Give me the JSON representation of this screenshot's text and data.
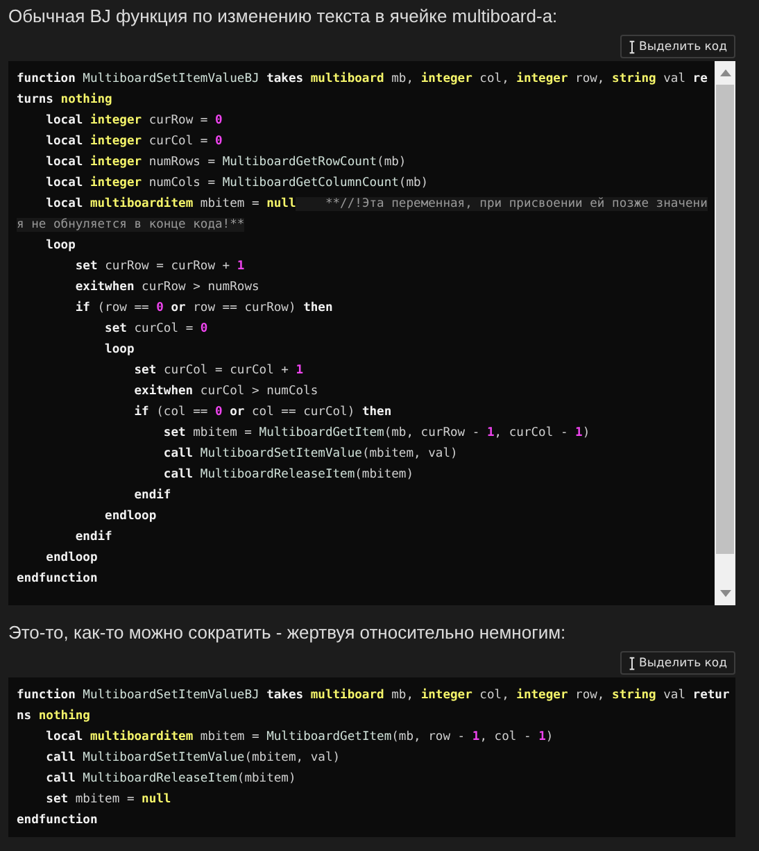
{
  "posts": [
    {
      "text": "Обычная BJ функция по изменению текста в ячейке multiboard-а:",
      "select_button": "Выделить код",
      "code": {
        "scrollable": true,
        "lines": [
          [
            {
              "kind": "kw",
              "text": "function "
            },
            {
              "kind": "fn",
              "text": "MultiboardSetItemValueBJ"
            },
            {
              "kind": "kw",
              "text": " takes "
            },
            {
              "kind": "type",
              "text": "multiboard"
            },
            {
              "kind": "plain",
              "text": " mb, "
            },
            {
              "kind": "type",
              "text": "integer"
            },
            {
              "kind": "plain",
              "text": " col, "
            },
            {
              "kind": "type",
              "text": "integer"
            },
            {
              "kind": "plain",
              "text": " row, "
            },
            {
              "kind": "type",
              "text": "string"
            },
            {
              "kind": "plain",
              "text": " val "
            },
            {
              "kind": "kw",
              "text": "re"
            }
          ],
          [
            {
              "kind": "kw",
              "text": "turns "
            },
            {
              "kind": "type",
              "text": "nothing"
            }
          ],
          [
            {
              "kind": "kw",
              "text": "    local "
            },
            {
              "kind": "type",
              "text": "integer"
            },
            {
              "kind": "plain",
              "text": " curRow = "
            },
            {
              "kind": "num",
              "text": "0"
            }
          ],
          [
            {
              "kind": "kw",
              "text": "    local "
            },
            {
              "kind": "type",
              "text": "integer"
            },
            {
              "kind": "plain",
              "text": " curCol = "
            },
            {
              "kind": "num",
              "text": "0"
            }
          ],
          [
            {
              "kind": "kw",
              "text": "    local "
            },
            {
              "kind": "type",
              "text": "integer"
            },
            {
              "kind": "plain",
              "text": " numRows = "
            },
            {
              "kind": "fn",
              "text": "MultiboardGetRowCount"
            },
            {
              "kind": "plain",
              "text": "(mb)"
            }
          ],
          [
            {
              "kind": "kw",
              "text": "    local "
            },
            {
              "kind": "type",
              "text": "integer"
            },
            {
              "kind": "plain",
              "text": " numCols = "
            },
            {
              "kind": "fn",
              "text": "MultiboardGetColumnCount"
            },
            {
              "kind": "plain",
              "text": "(mb)"
            }
          ],
          [
            {
              "kind": "kw",
              "text": "    local "
            },
            {
              "kind": "type",
              "text": "multiboarditem"
            },
            {
              "kind": "plain",
              "text": " mbitem = "
            },
            {
              "kind": "type",
              "text": "null"
            },
            {
              "kind": "comment",
              "text": "    **//!Эта переменная, при присвоении ей позже значени"
            }
          ],
          [
            {
              "kind": "comment",
              "text": "я не обнуляется в конце кода!**"
            }
          ],
          [
            {
              "kind": "kw",
              "text": "    loop"
            }
          ],
          [
            {
              "kind": "kw",
              "text": "        set "
            },
            {
              "kind": "plain",
              "text": "curRow = curRow + "
            },
            {
              "kind": "num",
              "text": "1"
            }
          ],
          [
            {
              "kind": "kw",
              "text": "        exitwhen "
            },
            {
              "kind": "plain",
              "text": "curRow > numRows"
            }
          ],
          [
            {
              "kind": "kw",
              "text": "        if "
            },
            {
              "kind": "plain",
              "text": "(row == "
            },
            {
              "kind": "num",
              "text": "0"
            },
            {
              "kind": "kw",
              "text": " or "
            },
            {
              "kind": "plain",
              "text": "row == curRow) "
            },
            {
              "kind": "kw",
              "text": "then"
            }
          ],
          [
            {
              "kind": "kw",
              "text": "            set "
            },
            {
              "kind": "plain",
              "text": "curCol = "
            },
            {
              "kind": "num",
              "text": "0"
            }
          ],
          [
            {
              "kind": "kw",
              "text": "            loop"
            }
          ],
          [
            {
              "kind": "kw",
              "text": "                set "
            },
            {
              "kind": "plain",
              "text": "curCol = curCol + "
            },
            {
              "kind": "num",
              "text": "1"
            }
          ],
          [
            {
              "kind": "kw",
              "text": "                exitwhen "
            },
            {
              "kind": "plain",
              "text": "curCol > numCols"
            }
          ],
          [
            {
              "kind": "kw",
              "text": "                if "
            },
            {
              "kind": "plain",
              "text": "(col == "
            },
            {
              "kind": "num",
              "text": "0"
            },
            {
              "kind": "kw",
              "text": " or "
            },
            {
              "kind": "plain",
              "text": "col == curCol) "
            },
            {
              "kind": "kw",
              "text": "then"
            }
          ],
          [
            {
              "kind": "kw",
              "text": "                    set "
            },
            {
              "kind": "plain",
              "text": "mbitem = "
            },
            {
              "kind": "fn",
              "text": "MultiboardGetItem"
            },
            {
              "kind": "plain",
              "text": "(mb, curRow - "
            },
            {
              "kind": "num",
              "text": "1"
            },
            {
              "kind": "plain",
              "text": ", curCol - "
            },
            {
              "kind": "num",
              "text": "1"
            },
            {
              "kind": "plain",
              "text": ")"
            }
          ],
          [
            {
              "kind": "kw",
              "text": "                    call "
            },
            {
              "kind": "fn",
              "text": "MultiboardSetItemValue"
            },
            {
              "kind": "plain",
              "text": "(mbitem, val)"
            }
          ],
          [
            {
              "kind": "kw",
              "text": "                    call "
            },
            {
              "kind": "fn",
              "text": "MultiboardReleaseItem"
            },
            {
              "kind": "plain",
              "text": "(mbitem)"
            }
          ],
          [
            {
              "kind": "kw",
              "text": "                endif"
            }
          ],
          [
            {
              "kind": "kw",
              "text": "            endloop"
            }
          ],
          [
            {
              "kind": "kw",
              "text": "        endif"
            }
          ],
          [
            {
              "kind": "kw",
              "text": "    endloop"
            }
          ],
          [
            {
              "kind": "kw",
              "text": "endfunction"
            }
          ]
        ]
      }
    },
    {
      "text": "Это-то, как-то можно сократить - жертвуя относительно немногим:",
      "select_button": "Выделить код",
      "code": {
        "scrollable": false,
        "lines": [
          [
            {
              "kind": "kw",
              "text": "function "
            },
            {
              "kind": "fn",
              "text": "MultiboardSetItemValueBJ"
            },
            {
              "kind": "kw",
              "text": " takes "
            },
            {
              "kind": "type",
              "text": "multiboard"
            },
            {
              "kind": "plain",
              "text": " mb, "
            },
            {
              "kind": "type",
              "text": "integer"
            },
            {
              "kind": "plain",
              "text": " col, "
            },
            {
              "kind": "type",
              "text": "integer"
            },
            {
              "kind": "plain",
              "text": " row, "
            },
            {
              "kind": "type",
              "text": "string"
            },
            {
              "kind": "plain",
              "text": " val "
            },
            {
              "kind": "kw",
              "text": "retur"
            }
          ],
          [
            {
              "kind": "kw",
              "text": "ns "
            },
            {
              "kind": "type",
              "text": "nothing"
            }
          ],
          [
            {
              "kind": "kw",
              "text": "    local "
            },
            {
              "kind": "type",
              "text": "multiboarditem"
            },
            {
              "kind": "plain",
              "text": " mbitem = "
            },
            {
              "kind": "fn",
              "text": "MultiboardGetItem"
            },
            {
              "kind": "plain",
              "text": "(mb, row - "
            },
            {
              "kind": "num",
              "text": "1"
            },
            {
              "kind": "plain",
              "text": ", col - "
            },
            {
              "kind": "num",
              "text": "1"
            },
            {
              "kind": "plain",
              "text": ")"
            }
          ],
          [
            {
              "kind": "kw",
              "text": "    call "
            },
            {
              "kind": "fn",
              "text": "MultiboardSetItemValue"
            },
            {
              "kind": "plain",
              "text": "(mbitem, val)"
            }
          ],
          [
            {
              "kind": "kw",
              "text": "    call "
            },
            {
              "kind": "fn",
              "text": "MultiboardReleaseItem"
            },
            {
              "kind": "plain",
              "text": "(mbitem)"
            }
          ],
          [
            {
              "kind": "kw",
              "text": "    set "
            },
            {
              "kind": "plain",
              "text": "mbitem = "
            },
            {
              "kind": "type",
              "text": "null"
            }
          ],
          [
            {
              "kind": "kw",
              "text": "endfunction"
            }
          ]
        ]
      }
    }
  ]
}
